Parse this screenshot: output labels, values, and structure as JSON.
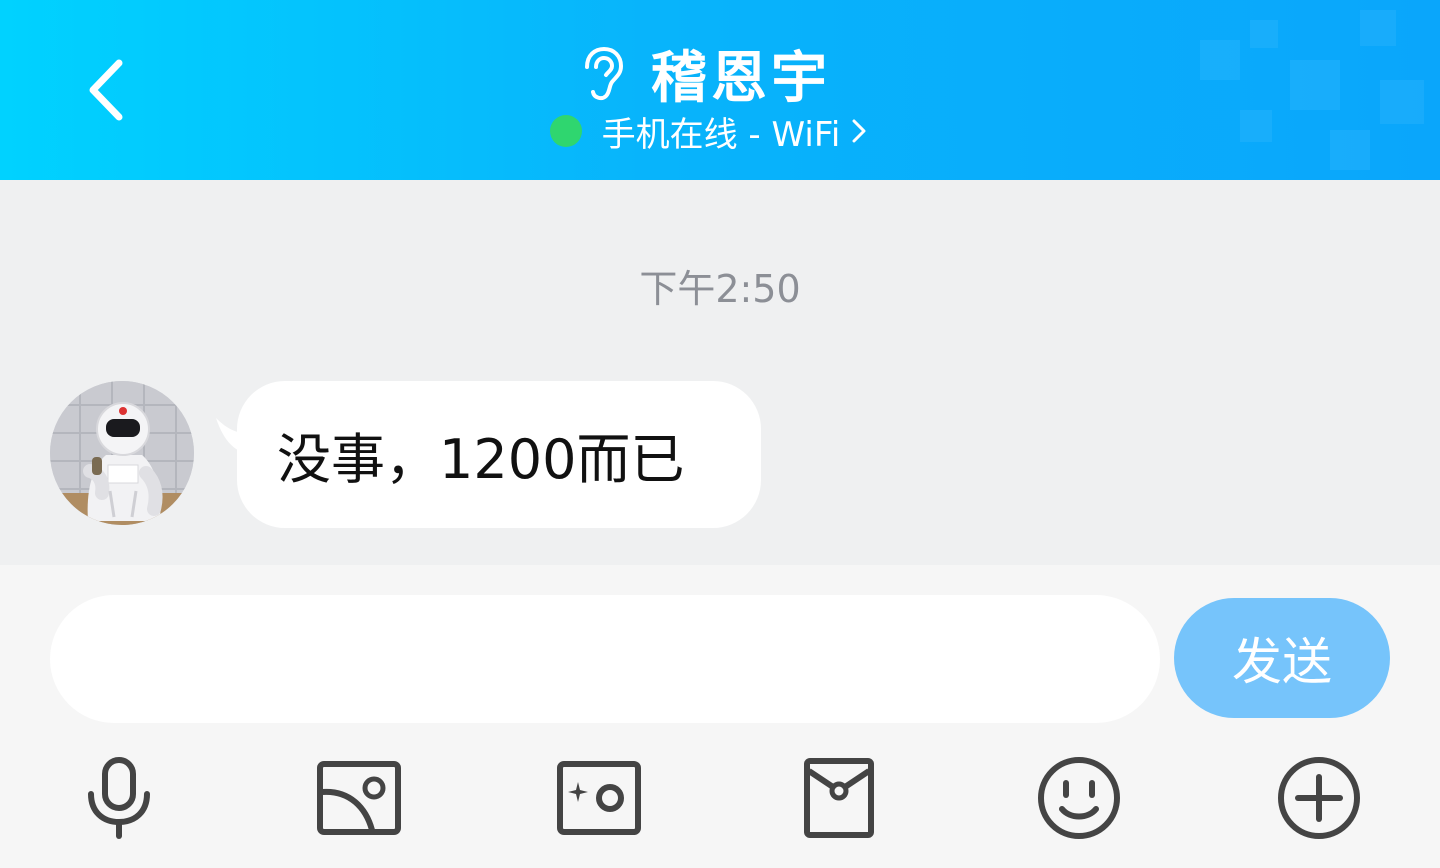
{
  "header": {
    "contact_name": "稽恩宇",
    "status_text": "手机在线 - WiFi",
    "status_color": "#2fd66f",
    "gradient_start": "#00d2ff",
    "gradient_end": "#0aa6fb",
    "icons": {
      "back": "chevron-left-icon",
      "listen_mode": "ear-icon",
      "status_detail": "chevron-right-icon"
    }
  },
  "chat": {
    "timestamp": "下午2:50",
    "messages": [
      {
        "direction": "incoming",
        "text": "没事，1200而已",
        "avatar": "astronaut-avatar"
      }
    ]
  },
  "input_bar": {
    "input_value": "",
    "input_placeholder": "",
    "send_label": "发送",
    "send_color": "#76c4fb",
    "toolbar": [
      {
        "name": "voice",
        "icon": "microphone-icon"
      },
      {
        "name": "photo",
        "icon": "image-icon"
      },
      {
        "name": "camera",
        "icon": "camera-icon"
      },
      {
        "name": "red-packet",
        "icon": "red-packet-icon"
      },
      {
        "name": "emoji",
        "icon": "smiley-icon"
      },
      {
        "name": "more",
        "icon": "plus-circle-icon"
      }
    ]
  }
}
